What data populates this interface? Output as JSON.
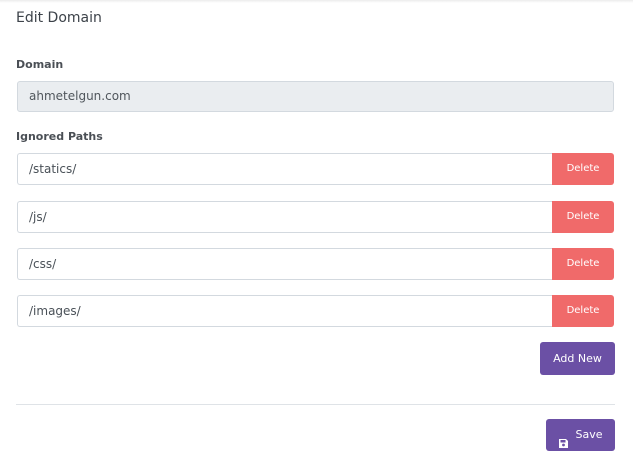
{
  "form": {
    "title": "Edit Domain",
    "domain_label": "Domain",
    "domain_value": "ahmetelgun.com",
    "ignored_paths_label": "Ignored Paths",
    "ignored_paths": [
      {
        "value": "/statics/",
        "delete_label": "Delete"
      },
      {
        "value": "/js/",
        "delete_label": "Delete"
      },
      {
        "value": "/css/",
        "delete_label": "Delete"
      },
      {
        "value": "/images/",
        "delete_label": "Delete"
      }
    ],
    "add_new_label": "Add New",
    "save_label": "Save",
    "save_icon": "floppy-disk-icon"
  },
  "colors": {
    "accent": "#6b50a5",
    "danger": "#f06a6a",
    "readonly_bg": "#eaedf0"
  }
}
